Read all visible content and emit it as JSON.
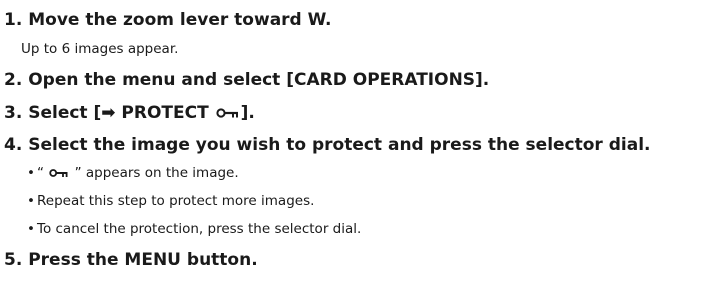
{
  "steps": [
    {
      "number": "1.",
      "text": "Move the zoom lever toward W.",
      "note": "Up to 6 images appear."
    },
    {
      "number": "2.",
      "text": "Open the menu and select [CARD OPERATIONS]."
    },
    {
      "number": "3.",
      "text_before": "Select [➡ PROTECT ",
      "text_after": "]."
    },
    {
      "number": "4.",
      "text": "Select the image you wish to protect and press the selector dial.",
      "bullets": [
        {
          "before": "“ ",
          "after": " ” appears on the image."
        },
        {
          "text": "Repeat this step to protect more images."
        },
        {
          "text": "To cancel the protection, press the selector dial."
        }
      ]
    },
    {
      "number": "5.",
      "text": "Press the MENU button."
    }
  ],
  "bullet_char": "•",
  "icons": {
    "protect": "key-icon"
  }
}
